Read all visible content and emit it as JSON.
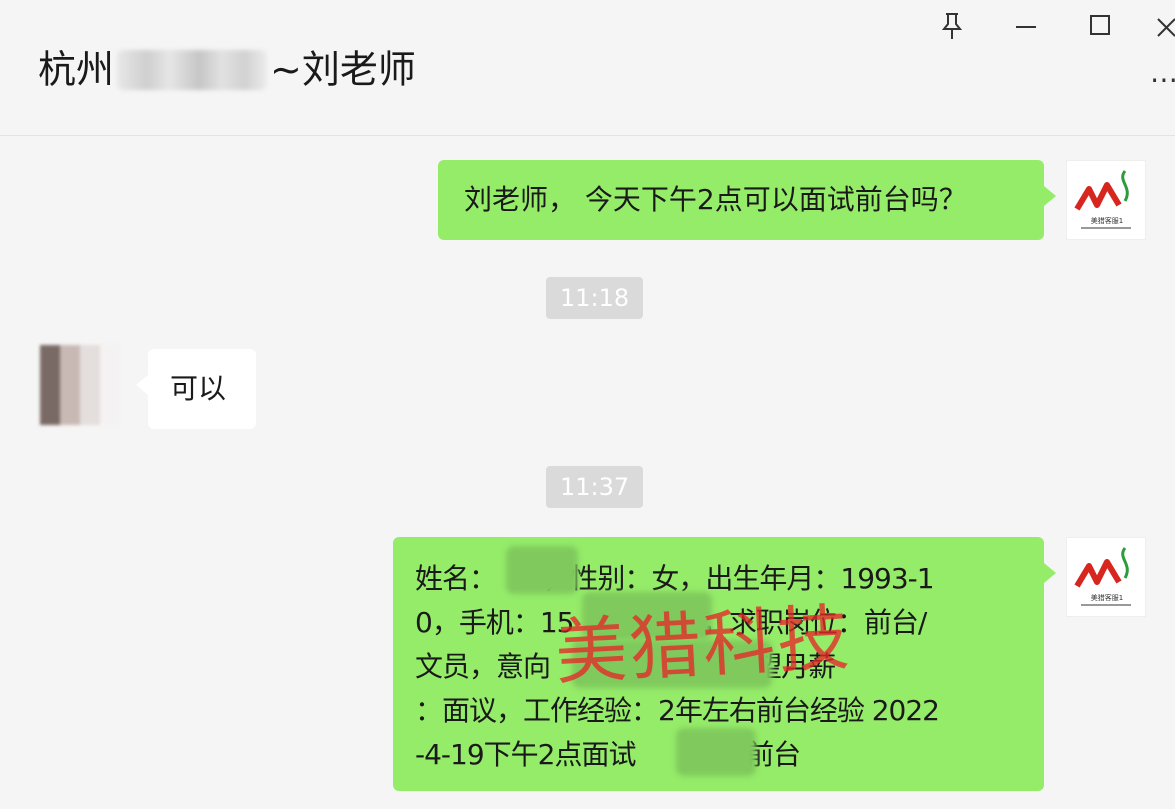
{
  "header": {
    "title_prefix": "杭州",
    "title_suffix": "~刘老师",
    "pin_icon": "pin-icon",
    "minimize_icon": "minimize-icon",
    "maximize_icon": "maximize-icon",
    "close_icon": "close-icon",
    "more_icon": "more-icon"
  },
  "messages": [
    {
      "sender": "me",
      "text": "刘老师， 今天下午2点可以面试前台吗？"
    },
    {
      "time": "11:18"
    },
    {
      "sender": "contact",
      "text": "可以"
    },
    {
      "time": "11:37"
    },
    {
      "sender": "me",
      "lines": [
        "姓名：      ，性别：女，出生年月：1993-1",
        "0，手机：15            99，求职岗位：前台/",
        "文员，意向                   ，期望月薪",
        "：面议，工作经验：2年左右前台经验 2022",
        "-4-19下午2点面试              前台"
      ]
    }
  ],
  "avatar_brand": {
    "logo": "ML",
    "caption": "美猎客服1"
  },
  "watermark": "美猎科技",
  "colors": {
    "bubble_me": "#95ec69",
    "bubble_contact": "#ffffff",
    "background": "#f5f5f5",
    "watermark": "#e62828"
  }
}
